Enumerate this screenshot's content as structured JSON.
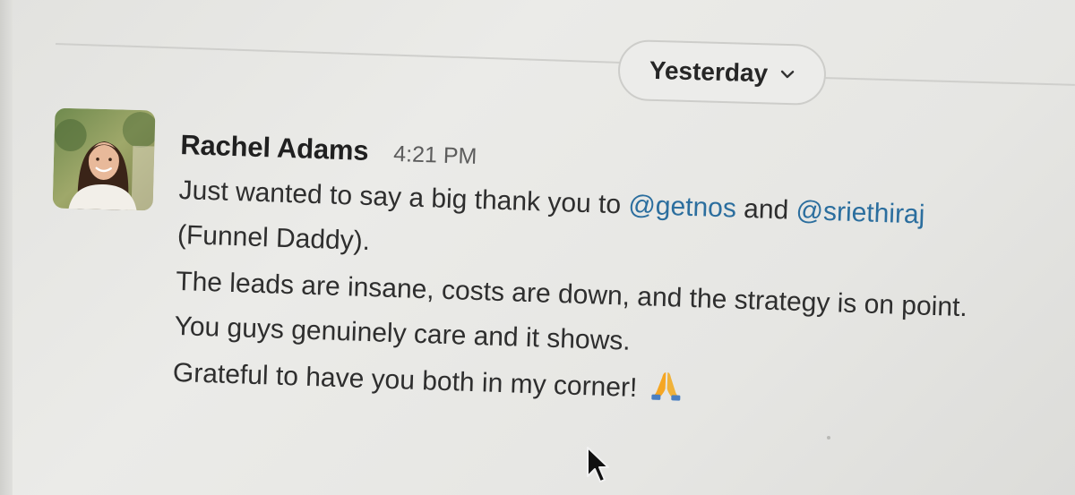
{
  "divider": {
    "date_label": "Yesterday",
    "chevron_icon": "chevron-down-icon"
  },
  "message": {
    "author": "Rachel Adams",
    "time": "4:21 PM",
    "avatar_icon": "user-avatar-photo",
    "line1": {
      "prefix": "Just wanted to say a big thank you to ",
      "mention1": "@getnos",
      "middle": " and ",
      "mention2": "@sriethiraj"
    },
    "line2": "(Funnel Daddy).",
    "line3": "The leads are insane, costs are down, and the strategy is on point.",
    "line4": "You guys genuinely care and it shows.",
    "line5": "Grateful to have you both in my corner!",
    "emoji_icon": "folded-hands-emoji"
  },
  "colors": {
    "mention": "#2b6e9e",
    "background": "#e8e8e5",
    "text": "#2e2e2e"
  },
  "cursor_icon": "mouse-pointer-icon"
}
